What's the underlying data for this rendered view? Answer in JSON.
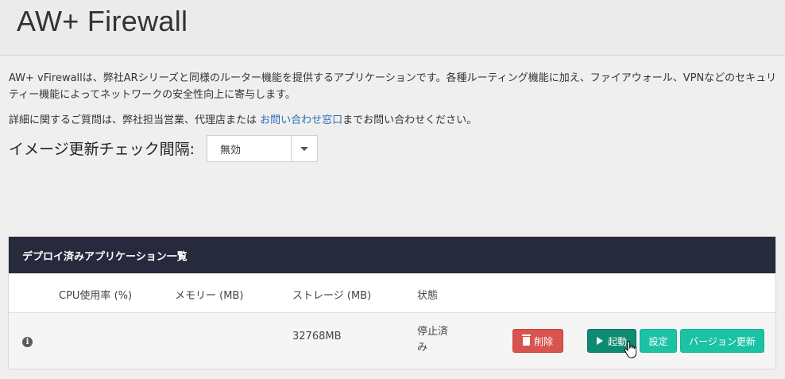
{
  "header": {
    "title": "AW+ Firewall"
  },
  "description": "AW+ vFirewallは、弊社ARシリーズと同様のルーター機能を提供するアプリケーションです。各種ルーティング機能に加え、ファイアウォール、VPNなどのセキュリティー機能によってネットワークの安全性向上に寄与します。",
  "contact": {
    "prefix": "詳細に関するご質問は、弊社担当営業、代理店または ",
    "link": "お問い合わせ窓口",
    "suffix": "までお問い合わせください。"
  },
  "update_check": {
    "label": "イメージ更新チェック間隔:",
    "selected": "無効"
  },
  "panel": {
    "title": "デプロイ済みアプリケーション一覧",
    "columns": {
      "cpu": "CPU使用率 (%)",
      "memory": "メモリー (MB)",
      "storage": "ストレージ (MB)",
      "status": "状態"
    },
    "row": {
      "cpu": "",
      "memory": "",
      "storage": "32768MB",
      "status": "停止済み",
      "buttons": {
        "delete": "削除",
        "start": "起動",
        "settings": "設定",
        "update": "バージョン更新"
      }
    }
  },
  "icons": {
    "info": "info-icon",
    "delete": "trash-icon",
    "start": "play-icon",
    "select": "chevron-down-icon"
  },
  "colors": {
    "panel_header": "#272a3c",
    "delete": "#d9534f",
    "start": "#0d8a72",
    "action": "#1cc2a4",
    "link": "#2a6db4"
  }
}
